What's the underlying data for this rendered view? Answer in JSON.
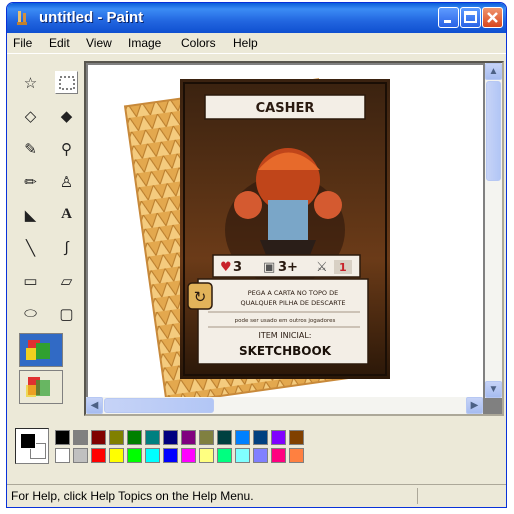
{
  "window": {
    "title": "untitled - Paint"
  },
  "menu": [
    "File",
    "Edit",
    "View",
    "Image",
    "Colors",
    "Help"
  ],
  "card": {
    "name": "CASHER",
    "stat_hearts": "3",
    "stat_dice": "3+",
    "stat_attack": "1",
    "ability_line1": "PEGA A CARTA NO TOPO DE",
    "ability_line2": "QUALQUER PILHA DE DESCARTE",
    "note": "pode ser usado em outros jogadores",
    "item_label": "ITEM INICIAL:",
    "item_name": "SKETCHBOOK"
  },
  "palette": {
    "top": [
      "#000000",
      "#808080",
      "#800000",
      "#808000",
      "#008000",
      "#008080",
      "#000080",
      "#800080",
      "#808040",
      "#004040",
      "#0080ff",
      "#004080",
      "#8000ff",
      "#804000"
    ],
    "bottom": [
      "#ffffff",
      "#c0c0c0",
      "#ff0000",
      "#ffff00",
      "#00ff00",
      "#00ffff",
      "#0000ff",
      "#ff00ff",
      "#ffff80",
      "#00ff80",
      "#80ffff",
      "#8080ff",
      "#ff0080",
      "#ff8040"
    ]
  },
  "status": {
    "help_text": "For Help, click Help Topics on the Help Menu."
  }
}
